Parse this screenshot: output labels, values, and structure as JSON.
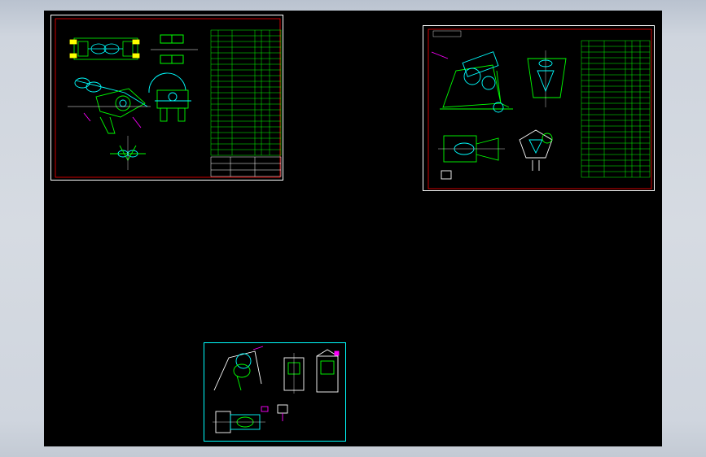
{
  "app": {
    "background_color": "#000000",
    "frame_color": "#c8ced6"
  },
  "sheets": [
    {
      "id": "sheet-1",
      "border_color": "#ffffff",
      "frame_color": "#ff0000",
      "has_title_block": true
    },
    {
      "id": "sheet-2",
      "border_color": "#ffffff",
      "frame_color": "#ff0000",
      "has_title_block": true
    },
    {
      "id": "sheet-3",
      "border_color": "#00ffff",
      "frame_color": "#00ffff",
      "has_title_block": false
    }
  ],
  "colors": {
    "geometry_primary": "#00ff00",
    "geometry_secondary": "#00ffff",
    "dimension": "#ff00ff",
    "border": "#ff0000",
    "text": "#ffffff"
  }
}
